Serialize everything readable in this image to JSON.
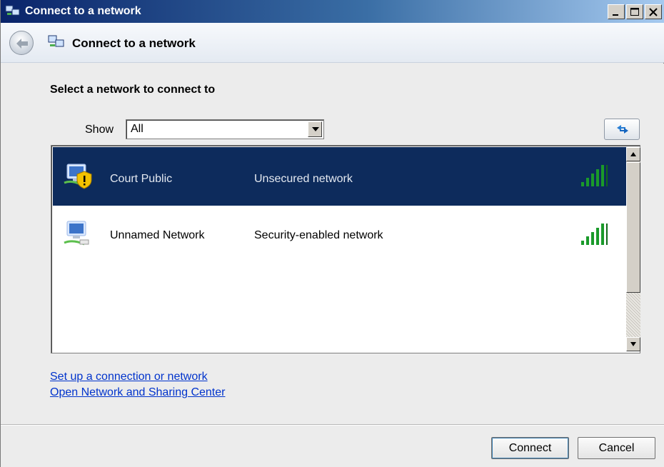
{
  "window": {
    "title": "Connect to a network"
  },
  "nav": {
    "title": "Connect to a network"
  },
  "main": {
    "heading": "Select a network to connect to",
    "show_label": "Show",
    "show_value": "All"
  },
  "networks": [
    {
      "name": "Court Public",
      "security": "Unsecured network",
      "signal_bars": 5,
      "selected": true
    },
    {
      "name": "Unnamed Network",
      "security": "Security-enabled network",
      "signal_bars": 5,
      "selected": false
    }
  ],
  "links": {
    "setup": "Set up a connection or network",
    "sharing": "Open Network and Sharing Center"
  },
  "buttons": {
    "connect": "Connect",
    "cancel": "Cancel"
  },
  "icons": {
    "title": "network-icon",
    "back": "back-arrow-icon",
    "refresh": "refresh-icon",
    "unsecured": "unsecured-network-icon",
    "secured": "network-computer-icon",
    "signal": "signal-strength-icon"
  },
  "colors": {
    "selection": "#0d2b5c",
    "signal": "#1a9a2a",
    "link": "#0033cc"
  }
}
